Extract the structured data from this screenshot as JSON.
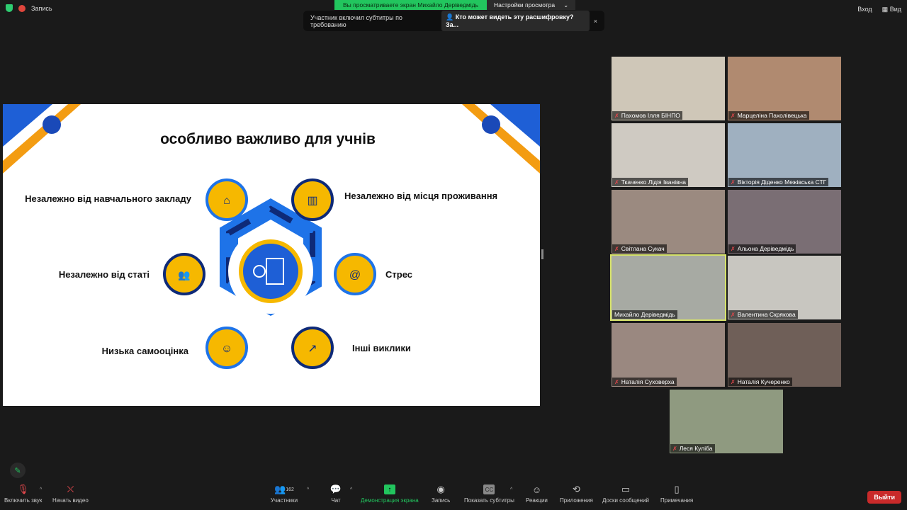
{
  "top": {
    "recording": "Запись",
    "viewing": "Вы просматриваете экран Михайло Деріведмідь",
    "view_settings": "Настройки просмотра",
    "caption_notice": "Участник включил субтитры по требованию",
    "caption_who": "Кто может видеть эту расшифровку? За...",
    "close": "×",
    "enter": "Вход",
    "view": "Вид"
  },
  "slide": {
    "title": "особливо важливо для учнів",
    "items": [
      "Незалежно від навчального закладу",
      "Незалежно від місця проживання",
      "Стрес",
      "Інші виклики",
      "Низька самооцінка",
      "Незалежно від статі"
    ],
    "colors": {
      "navy": "#0e2a78",
      "blue": "#1e73e8",
      "yellow": "#f6b800",
      "orange": "#f39c12"
    }
  },
  "participants": [
    {
      "name": "Пахомов Ілля БІНПО",
      "bg": "#cfc7b8"
    },
    {
      "name": "Марцеліна Пахолівецька",
      "bg": "#b08a70"
    },
    {
      "name": "Ткаченко Лідія Іванівна",
      "bg": "#cfcac2"
    },
    {
      "name": "Вікторія Діденко Межівська СТГ",
      "bg": "#9fb0c0"
    },
    {
      "name": "Світлана Сукач",
      "bg": "#9b8a80"
    },
    {
      "name": "Альона Деріведмідь",
      "bg": "#7a6e74"
    },
    {
      "name": "Михайло Деріведмідь",
      "bg": "#a7aaa3"
    },
    {
      "name": "Валентина Скрякова",
      "bg": "#c8c6c0"
    },
    {
      "name": "Наталія Суховерха",
      "bg": "#9a8880"
    },
    {
      "name": "Наталія Кучеренко",
      "bg": "#6f5f58"
    },
    {
      "name": "Леся Куліба",
      "bg": "#8f9a80"
    }
  ],
  "toolbar": {
    "unmute": "Включить звук",
    "start_video": "Начать видео",
    "participants": "Участники",
    "participants_count": "162",
    "chat": "Чат",
    "share": "Демонстрация экрана",
    "record": "Запись",
    "captions": "Показать субтитры",
    "reactions": "Реакции",
    "apps": "Приложения",
    "whiteboards": "Доски сообщений",
    "notes": "Примечания",
    "leave": "Выйти"
  }
}
